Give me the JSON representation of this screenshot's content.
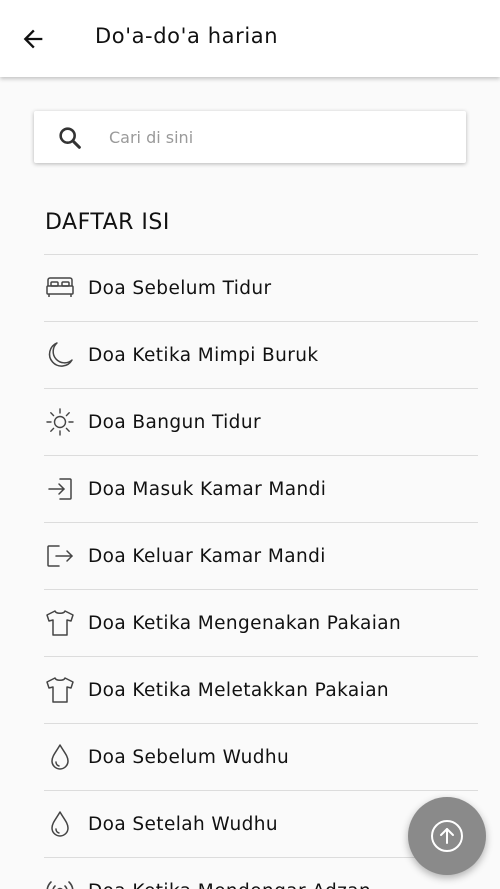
{
  "appbar": {
    "title": "Do'a-do'a harian",
    "back_icon": "arrow-left-icon"
  },
  "search": {
    "placeholder": "Cari di sini",
    "value": "",
    "icon": "search-icon"
  },
  "toc": {
    "heading": "DAFTAR ISI",
    "items": [
      {
        "label": "Doa Sebelum Tidur",
        "icon": "bed-icon"
      },
      {
        "label": "Doa Ketika Mimpi Buruk",
        "icon": "moon-icon"
      },
      {
        "label": "Doa Bangun Tidur",
        "icon": "sun-icon"
      },
      {
        "label": "Doa Masuk Kamar Mandi",
        "icon": "sign-in-icon"
      },
      {
        "label": "Doa Keluar Kamar Mandi",
        "icon": "sign-out-icon"
      },
      {
        "label": "Doa Ketika Mengenakan Pakaian",
        "icon": "shirt-icon"
      },
      {
        "label": "Doa Ketika Meletakkan Pakaian",
        "icon": "shirt-icon"
      },
      {
        "label": "Doa Sebelum Wudhu",
        "icon": "water-drop-icon"
      },
      {
        "label": "Doa Setelah Wudhu",
        "icon": "water-drop-icon"
      },
      {
        "label": "Doa Ketika Mendengar Adzan",
        "icon": "broadcast-icon"
      }
    ]
  },
  "fab": {
    "icon": "arrow-up-circle-icon"
  },
  "colors": {
    "fab_background": "#8a8a8a",
    "divider": "#dcdcdc",
    "placeholder": "#9a9a9a"
  }
}
